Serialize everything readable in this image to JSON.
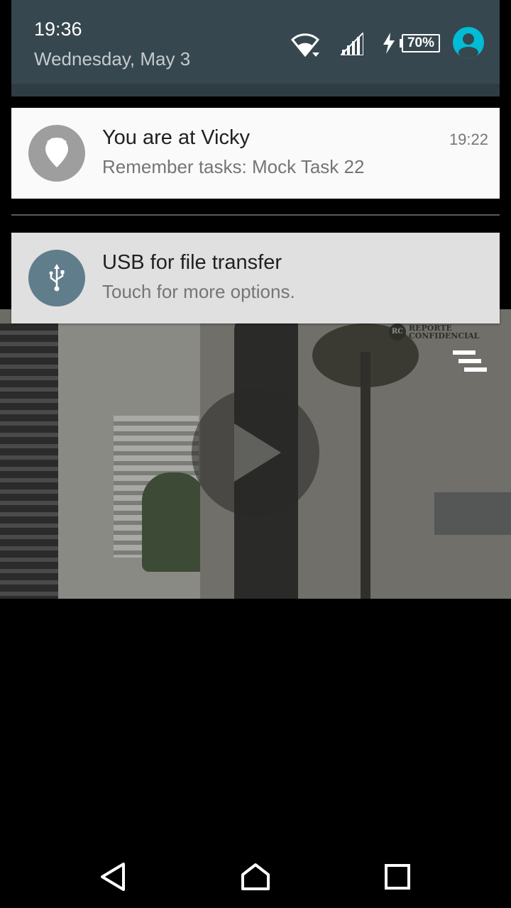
{
  "status": {
    "time": "19:36",
    "date": "Wednesday, May 3",
    "battery": "70%",
    "icons": [
      "wifi-icon",
      "cell-signal-icon",
      "charging-icon",
      "battery-icon",
      "user-avatar-icon"
    ]
  },
  "notifications": [
    {
      "icon": "location-pin-icon",
      "title": "You are at Vicky",
      "text": "Remember tasks: Mock Task 22",
      "time": "19:22"
    },
    {
      "icon": "usb-icon",
      "title": "USB for file transfer",
      "text": "Touch for more options."
    }
  ],
  "video": {
    "watermark_badge": "RC",
    "watermark_line1": "REPORTE",
    "watermark_line2": "CONFIDENCIAL",
    "icons": [
      "play-icon",
      "menu-icon"
    ]
  },
  "navbar": {
    "icons": [
      "back-icon",
      "home-icon",
      "recents-icon"
    ]
  },
  "colors": {
    "shade_header": "#37474f",
    "accent_avatar": "#00bcd4",
    "usb_icon_bg": "#607d8b"
  }
}
